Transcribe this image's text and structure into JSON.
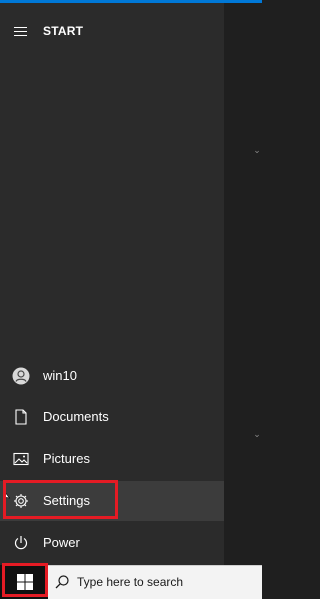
{
  "start_menu": {
    "title": "START",
    "items": [
      {
        "label": "win10",
        "icon": "user-avatar-icon"
      },
      {
        "label": "Documents",
        "icon": "document-icon"
      },
      {
        "label": "Pictures",
        "icon": "pictures-icon"
      },
      {
        "label": "Settings",
        "icon": "gear-icon"
      },
      {
        "label": "Power",
        "icon": "power-icon"
      }
    ]
  },
  "taskbar": {
    "search_placeholder": "Type here to search",
    "start_icon": "windows-logo-icon",
    "search_icon": "search-icon"
  },
  "colors": {
    "accent": "#0078d7",
    "highlight": "#e51b24",
    "menu_bg": "#2b2b2b"
  }
}
